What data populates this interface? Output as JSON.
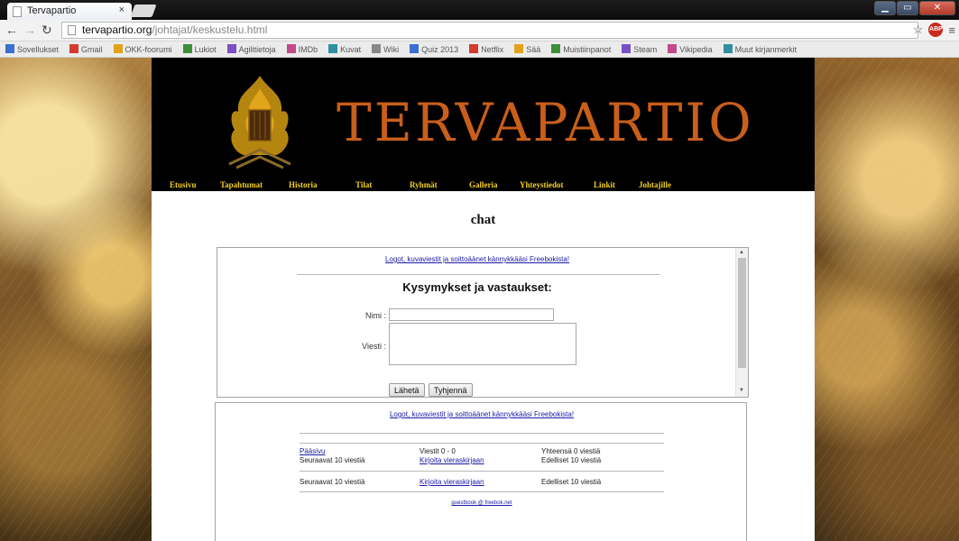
{
  "browser": {
    "tab_title": "Tervapartio",
    "tab_close": "×",
    "url_host": "tervapartio.org",
    "url_path": "/johtajat/keskustelu.html",
    "bookmarks": [
      "Sovellukset",
      "Gmail",
      "OKK-foorumi",
      "Lukiot",
      "Agilitietoja",
      "IMDb",
      "Kuvat",
      "Wiki",
      "Quiz 2013",
      "Netflix",
      "Sää",
      "Muistiinpanot",
      "Steam",
      "Vikipedia",
      "Muut kirjanmerkit"
    ]
  },
  "site": {
    "brand": "TERVAPARTIO",
    "nav": [
      "Etusivu",
      "Tapahtumat",
      "Historia",
      "Tilat",
      "Ryhmät",
      "Galleria",
      "Yhteystiedot",
      "Linkit",
      "Johtajille"
    ],
    "page_heading": "chat"
  },
  "form": {
    "promo": "Logot, kuvaviestit ja soittoäänet kännykkääsi Freebokista!",
    "title": "Kysymykset ja vastaukset:",
    "name_label": "Nimi :",
    "message_label": "Viesti :",
    "name_value": "",
    "message_value": "",
    "submit_label": "Lähetä",
    "clear_label": "Tyhjennä"
  },
  "guestbook": {
    "promo": "Logot, kuvaviestit ja soittoäänet kännykkääsi Freebokista!",
    "home_link": "Pääsivu",
    "next_10": "Seuraavat 10 viestiä",
    "messages_range": "Viestit 0 - 0",
    "write_link": "Kirjoita vieraskirjaan",
    "total": "Yhteensä 0 viestiä",
    "prev_10": "Edelliset 10 viestiä",
    "footer": "guestbook @ freebok.net"
  },
  "colors": {
    "nav_text": "#f3d21f",
    "brand": "#c95f1a",
    "link": "#1a1aa6"
  }
}
